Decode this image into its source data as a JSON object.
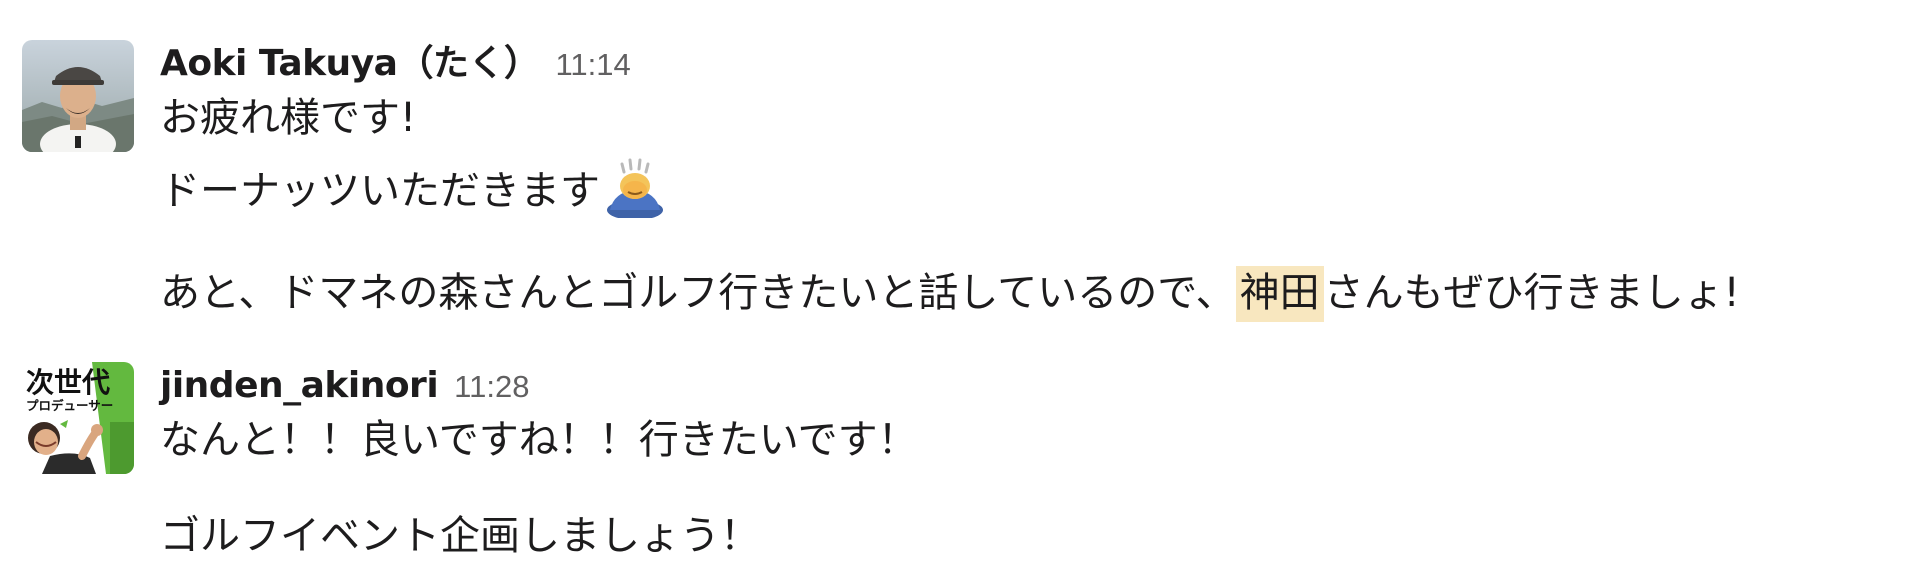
{
  "messages": [
    {
      "author": "Aoki Takuya（たく）",
      "time": "11:14",
      "lines": [
        "お疲れ様です!",
        "ドーナッツいただきます",
        {
          "before": "あと、ドマネの森さんとゴルフ行きたいと話しているので、",
          "mention": "神田",
          "after": "さんもぜひ行きましょ!"
        }
      ],
      "emoji": "person-bowing-emoji"
    },
    {
      "author": "jinden_akinori",
      "time": "11:28",
      "avatar_text": {
        "line1": "次世代",
        "line2": "プロデューサー"
      },
      "lines": [
        "なんと！！良いですね！！行きたいです！",
        "ゴルフイベント企画しましょう！"
      ]
    }
  ],
  "colors": {
    "author": "#1d1c1d",
    "timestamp": "#616061",
    "mention_highlight": "#f8e7bf",
    "avatar2_accent": "#63b93f"
  }
}
